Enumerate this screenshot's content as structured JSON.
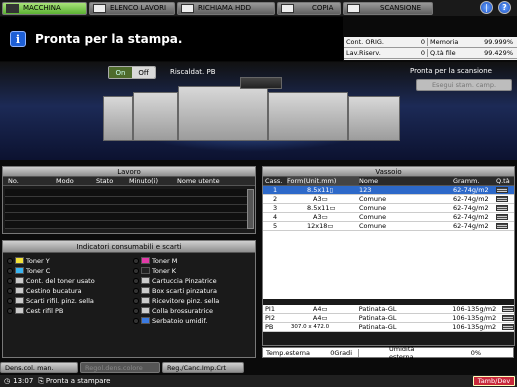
{
  "tabs": [
    {
      "label": "MACCHINA",
      "active": true,
      "icon": "printer-icon"
    },
    {
      "label": "ELENCO LAVORI",
      "active": false,
      "icon": "list-icon"
    },
    {
      "label": "RICHIAMA HDD",
      "active": false,
      "icon": "hdd-icon"
    },
    {
      "label": "COPIA",
      "active": false,
      "icon": "copy-icon"
    },
    {
      "label": "SCANSIONE",
      "active": false,
      "icon": "scan-icon"
    }
  ],
  "top_buttons": {
    "restore_label": "❘",
    "help_label": "?"
  },
  "message": {
    "icon_label": "i",
    "text": "Pronta per la stampa."
  },
  "counters": {
    "row1": {
      "label1": "Cont. ORIG.",
      "value1": "0",
      "label2": "Memoria",
      "value2": "99.999%"
    },
    "row2": {
      "label1": "Lav.Riserv.",
      "value1": "0",
      "label2": "Q.tà file",
      "value2": "99.429%"
    }
  },
  "machine": {
    "toggle_on": "On",
    "toggle_off": "Off",
    "preheat_label": "Riscaldat. PB",
    "scan_status": "Pronta per la scansione",
    "skip_button": "Esegui stam. camp."
  },
  "jobs": {
    "title": "Lavoro",
    "columns": [
      "No.",
      "Modo",
      "Stato",
      "Minuto(i)",
      "Nome utente"
    ],
    "rows": []
  },
  "consumables": {
    "title": "Indicatori consumabili e scarti",
    "left": [
      "Toner Y",
      "Toner C",
      "Cont. del toner usato",
      "Cestino bucatura",
      "Scarti rifil. pinz. sella",
      "Cest rifil PB"
    ],
    "right": [
      "Toner M",
      "Toner K",
      "Cartuccia Pinzatrice",
      "Box scarti pinzatura",
      "Ricevitore pinz. sella",
      "Colla brossuratrice",
      "Serbatoio umidif."
    ]
  },
  "trays": {
    "title": "Vassoio",
    "columns": [
      "Cass.",
      "Form(Unit.mm)",
      "Nome",
      "Gramm.",
      "Q.tà"
    ],
    "rows": [
      {
        "cass": "1",
        "size": "8.5x11▯",
        "name": "123",
        "weight": "62-74g/m2",
        "selected": true
      },
      {
        "cass": "2",
        "size": "A3▭",
        "name": "Comune",
        "weight": "62-74g/m2",
        "selected": false
      },
      {
        "cass": "3",
        "size": "8.5x11▭",
        "name": "Comune",
        "weight": "62-74g/m2",
        "selected": false
      },
      {
        "cass": "4",
        "size": "A3▭",
        "name": "Comune",
        "weight": "62-74g/m2",
        "selected": false
      },
      {
        "cass": "5",
        "size": "12x18▭",
        "name": "Comune",
        "weight": "62-74g/m2",
        "selected": false
      }
    ],
    "inserter_rows": [
      {
        "cass": "PI1",
        "size": "A4▭",
        "name": "Patinata-GL",
        "weight": "106-135g/m2"
      },
      {
        "cass": "PI2",
        "size": "A4▭",
        "name": "Patinata-GL",
        "weight": "106-135g/m2"
      },
      {
        "cass": "PB",
        "size": "307.0 x 472.0",
        "name": "Patinata-GL",
        "weight": "106-135g/m2"
      }
    ]
  },
  "environment": {
    "temp_label": "Temp.esterna",
    "temp_value": "0Gradi",
    "humidity_label": "Umidità esterna",
    "humidity_value": "0%"
  },
  "bottom_tabs": [
    {
      "label": "Dens.col. man.",
      "disabled": false
    },
    {
      "label": "Regol.dens.colore",
      "disabled": true
    },
    {
      "label": "Reg./Canc.Imp.Crt",
      "disabled": false
    }
  ],
  "status": {
    "time": "13:07",
    "text": "Pronta a stampare",
    "tandem": "Tamb/Dev"
  }
}
